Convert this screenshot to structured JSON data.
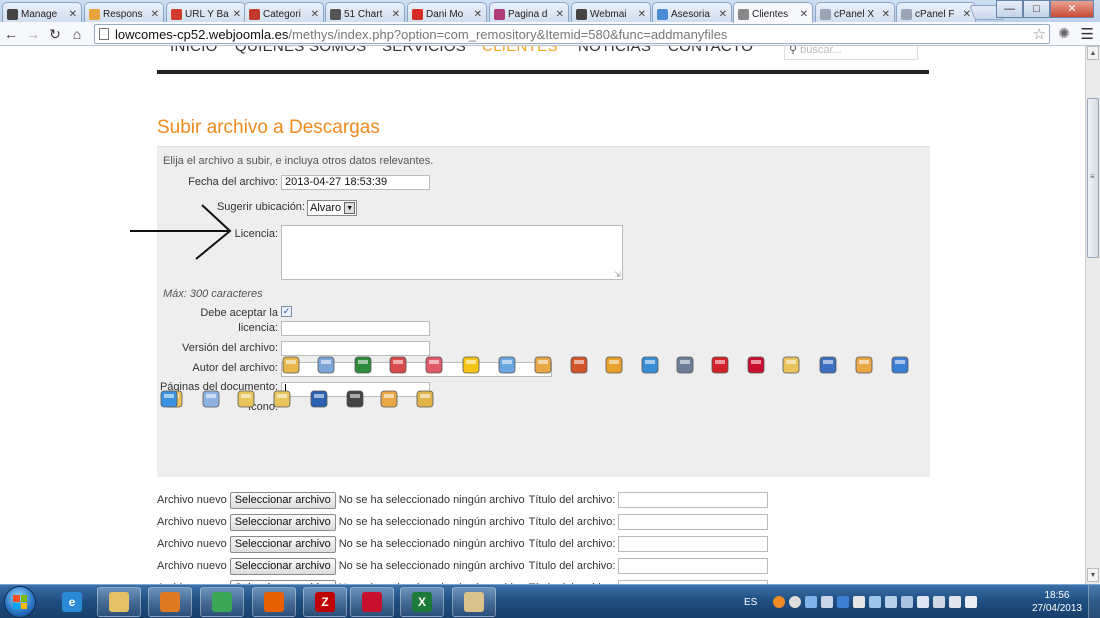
{
  "browser": {
    "tabs": [
      {
        "label": "Manage",
        "color": "#444444"
      },
      {
        "label": "Respons",
        "color": "#e8a33b"
      },
      {
        "label": "URL Y Ba",
        "color": "#d23b2e"
      },
      {
        "label": "Categori",
        "color": "#c0392b"
      },
      {
        "label": "51 Chart",
        "color": "#555555"
      },
      {
        "label": "Dani Mo",
        "color": "#d62a24"
      },
      {
        "label": "Pagina d",
        "color": "#b23b7a"
      },
      {
        "label": "Webmai",
        "color": "#444444"
      },
      {
        "label": "Asesoria",
        "color": "#4a8bd8"
      },
      {
        "label": "Clientes",
        "color": "#888888",
        "active": true
      },
      {
        "label": "cPanel X",
        "color": "#9aa5b5"
      },
      {
        "label": "cPanel F",
        "color": "#9aa5b5"
      }
    ],
    "url_host": "lowcomes-cp52.webjoomla.es",
    "url_path": "/methys/index.php?option=com_remository&Itemid=580&func=addmanyfiles"
  },
  "site": {
    "nav": [
      {
        "label": "INICIO"
      },
      {
        "label": "QUIENES SOMOS"
      },
      {
        "label": "SERVICIOS"
      },
      {
        "label": "CLIENTES",
        "active": true
      },
      {
        "label": "NOTICIAS"
      },
      {
        "label": "CONTACTO"
      }
    ],
    "search_placeholder": "buscar..."
  },
  "form": {
    "title": "Subir archivo a Descargas",
    "intro": "Elija el archivo a subir, e incluya otros datos relevantes.",
    "fecha_label": "Fecha del archivo:",
    "fecha_value": "2013-04-27 18:53:39",
    "ubicacion_label": "Sugerir ubicación:",
    "ubicacion_value": "Alvaro",
    "licencia_label": "Licencia:",
    "max_note": "Máx: 300 caracteres",
    "aceptar_label_1": "Debe aceptar la",
    "aceptar_label_2": "licencia:",
    "aceptar_checked": true,
    "version_label": "Versión del archivo:",
    "autor_label": "Autor del archivo:",
    "paginas_label": "Páginas del documento:",
    "icono_label": "Icono:",
    "icons": [
      "pencil-ruler-icon",
      "scroll-icon",
      "excel-icon",
      "drafting-icon",
      "graph-paper-icon",
      "star-icon",
      "image-icon",
      "package-icon",
      "powerpoint-icon",
      "gear-icon",
      "quicktime-icon",
      "tools-icon",
      "pdf-icon",
      "acrobat-icon",
      "folder-icon",
      "book-icon",
      "package-icon",
      "chat-icon",
      "folder-icon",
      "document-icon",
      "folder-icon",
      "folder-icon",
      "word-icon",
      "headset-icon",
      "package-icon",
      "zip-folder-icon",
      "apple-icon"
    ]
  },
  "uploads": {
    "rows": [
      {
        "label": "Archivo nuevo",
        "button": "Seleccionar archivo",
        "status": "No se ha seleccionado ningún archivo",
        "title_label": "Título del archivo:"
      },
      {
        "label": "Archivo nuevo",
        "button": "Seleccionar archivo",
        "status": "No se ha seleccionado ningún archivo",
        "title_label": "Título del archivo:"
      },
      {
        "label": "Archivo nuevo",
        "button": "Seleccionar archivo",
        "status": "No se ha seleccionado ningún archivo",
        "title_label": "Título del archivo:"
      },
      {
        "label": "Archivo nuevo",
        "button": "Seleccionar archivo",
        "status": "No se ha seleccionado ningún archivo",
        "title_label": "Título del archivo:"
      },
      {
        "label": "Archivo nuevo",
        "button": "Seleccionar archivo",
        "status": "No se ha seleccionado ningún archivo",
        "title_label": "Título del archivo:"
      }
    ]
  },
  "taskbar": {
    "apps": [
      {
        "name": "internet-explorer-icon",
        "color": "#2a8ad8",
        "glyph": "e"
      },
      {
        "name": "file-explorer-icon",
        "color": "#e6c067",
        "glyph": ""
      },
      {
        "name": "media-player-icon",
        "color": "#e07a22",
        "glyph": ""
      },
      {
        "name": "chrome-icon",
        "color": "#3aa757",
        "glyph": ""
      },
      {
        "name": "firefox-icon",
        "color": "#e66000",
        "glyph": ""
      },
      {
        "name": "filezilla-icon",
        "color": "#bf0000",
        "glyph": "Z"
      },
      {
        "name": "acrobat-icon",
        "color": "#c8102e",
        "glyph": ""
      },
      {
        "name": "excel-icon",
        "color": "#1d7a3a",
        "glyph": "X"
      },
      {
        "name": "paint-icon",
        "color": "#d9c38a",
        "glyph": ""
      }
    ],
    "lang": "ES",
    "time": "18:56",
    "date": "27/04/2013"
  }
}
